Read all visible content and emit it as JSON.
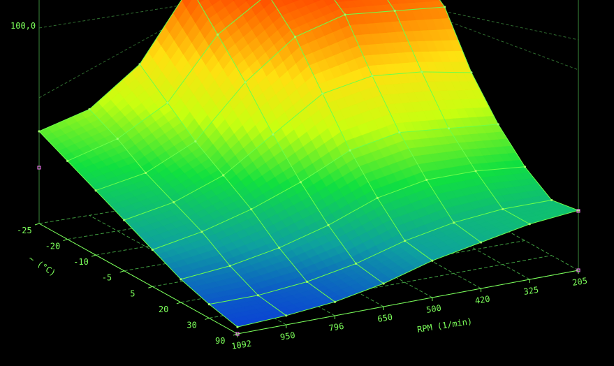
{
  "chart_data": {
    "type": "surface3d",
    "title": "",
    "z_tick_label": "100,0",
    "x_axis": {
      "label": "RPM (1/min)",
      "ticks": [
        "1092",
        "950",
        "796",
        "650",
        "500",
        "420",
        "325",
        "205"
      ]
    },
    "y_axis": {
      "label": "~ (°C)",
      "ticks": [
        "-25",
        "-20",
        "-10",
        "-5",
        "5",
        "20",
        "30",
        "90"
      ]
    },
    "z_range": [
      0,
      100
    ],
    "grid": true,
    "z_values": [
      [
        40,
        46,
        62,
        92,
        100,
        100,
        100,
        100
      ],
      [
        34,
        40,
        52,
        78,
        92,
        96,
        95,
        92
      ],
      [
        28,
        32,
        42,
        64,
        80,
        86,
        84,
        82
      ],
      [
        22,
        26,
        34,
        48,
        62,
        66,
        64,
        60
      ],
      [
        16,
        20,
        26,
        34,
        44,
        48,
        46,
        44
      ],
      [
        10,
        12,
        16,
        22,
        30,
        34,
        34,
        32
      ],
      [
        6,
        6,
        8,
        12,
        18,
        22,
        24,
        24
      ],
      [
        3,
        4,
        6,
        10,
        16,
        20,
        24,
        26
      ]
    ],
    "colors": {
      "axis": "#7cff5a",
      "mesh": "#6dff4a",
      "background": "#000000",
      "marker": "#ff80ff",
      "gradient": [
        "#0a2ee0",
        "#0ea0a0",
        "#10e040",
        "#c8ff10",
        "#ffe010",
        "#ff7a00",
        "#ff1a00"
      ]
    }
  }
}
